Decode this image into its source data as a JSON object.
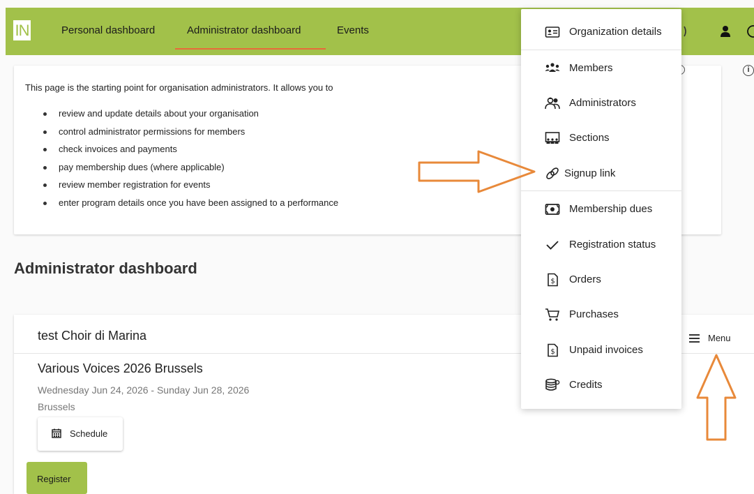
{
  "app": {
    "logo_text": "IN",
    "nav": [
      {
        "label": "Personal dashboard"
      },
      {
        "label": "Administrator dashboard"
      },
      {
        "label": "Events"
      }
    ]
  },
  "info": {
    "intro": "This page is the starting point for organisation administrators. It allows you to",
    "bullets": [
      "review and update details about your organisation",
      "control administrator permissions for members",
      "check invoices and payments",
      "pay membership dues (where applicable)",
      "review member registration for events",
      "enter program details once you have been assigned to a performance"
    ]
  },
  "page_title": "Administrator dashboard",
  "org": {
    "name": "test Choir di Marina",
    "menu_label": "Menu",
    "event": {
      "title": "Various Voices 2026 Brussels",
      "dates": "Wednesday Jun 24, 2026 - Sunday Jun 28, 2026",
      "city": "Brussels",
      "schedule_label": "Schedule",
      "register_label": "Register"
    }
  },
  "dropdown": {
    "items": [
      {
        "label": "Organization details",
        "icon": "id-card-icon"
      },
      {
        "label": "Members",
        "icon": "members-icon"
      },
      {
        "label": "Administrators",
        "icon": "administrators-icon"
      },
      {
        "label": "Sections",
        "icon": "sections-icon"
      },
      {
        "label": "Signup link",
        "icon": "link-icon"
      },
      {
        "label": "Membership dues",
        "icon": "money-icon"
      },
      {
        "label": "Registration status",
        "icon": "check-icon"
      },
      {
        "label": "Orders",
        "icon": "invoice-icon"
      },
      {
        "label": "Purchases",
        "icon": "cart-icon"
      },
      {
        "label": "Unpaid invoices",
        "icon": "invoice-icon"
      },
      {
        "label": "Credits",
        "icon": "coins-icon"
      }
    ]
  },
  "colors": {
    "brand_green": "#a2c14a",
    "nav_underline": "#e86a3a",
    "annotation_orange": "#e8893a"
  }
}
